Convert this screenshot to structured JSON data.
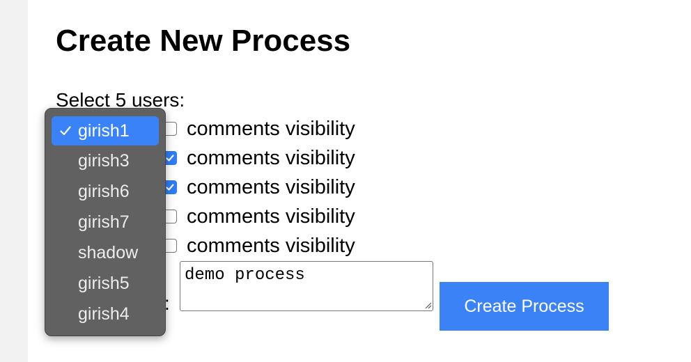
{
  "page": {
    "title": "Create New Process",
    "select_label": "Select 5 users:"
  },
  "users": [
    {
      "label": "comments visibility",
      "checked": false
    },
    {
      "label": "comments visibility",
      "checked": true
    },
    {
      "label": "comments visibility",
      "checked": true
    },
    {
      "label": "comments visibility",
      "checked": false
    },
    {
      "label": "comments visibility",
      "checked": false
    }
  ],
  "description": {
    "colon": ":",
    "value": "demo process"
  },
  "create_button": {
    "label": "Create Process"
  },
  "dropdown": {
    "selected": "girish1",
    "options": [
      "girish1",
      "girish3",
      "girish6",
      "girish7",
      "shadow",
      "girish5",
      "girish4"
    ]
  },
  "colors": {
    "accent": "#3b82f6",
    "dropdown_bg": "#616161",
    "dropdown_selected": "#3a82f7"
  },
  "icons": {
    "checkmark": "checkmark-icon",
    "resize": "resize-grip-icon"
  }
}
